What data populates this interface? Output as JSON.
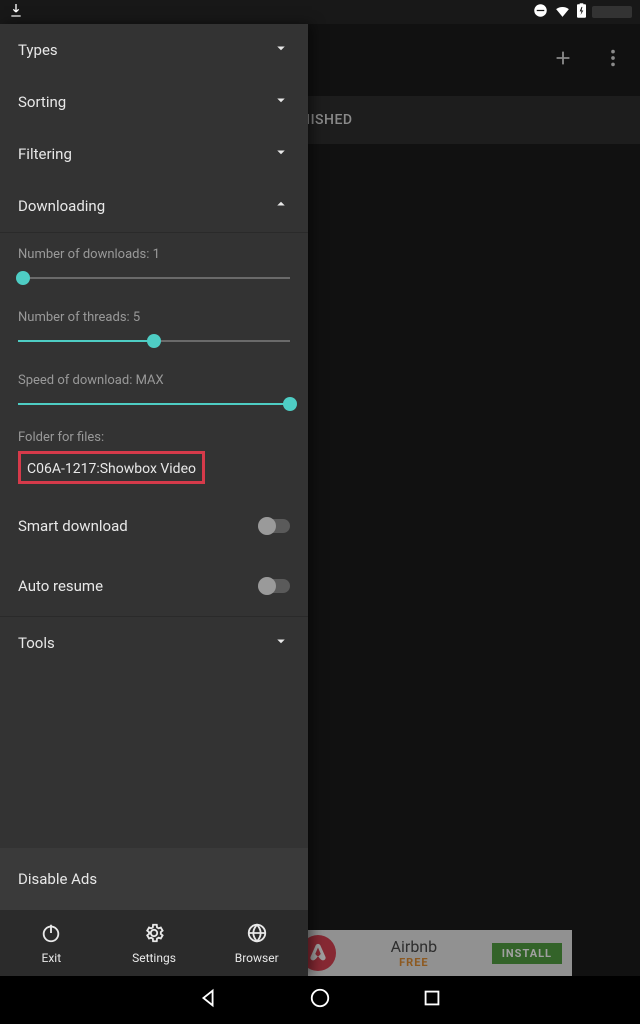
{
  "statusbar": {
    "dnd_icon": "do-not-disturb",
    "wifi_icon": "wifi",
    "batt_icon": "battery-charging"
  },
  "main": {
    "add_icon": "plus",
    "overflow_icon": "more-vert",
    "tab_finished": "FINISHED"
  },
  "ad": {
    "title": "Airbnb",
    "subtitle": "FREE",
    "button": "INSTALL"
  },
  "drawer": {
    "sections": {
      "types": "Types",
      "sorting": "Sorting",
      "filtering": "Filtering",
      "downloading": "Downloading",
      "tools": "Tools"
    },
    "downloading": {
      "num_downloads_label": "Number of downloads: 1",
      "num_downloads_pct": 2,
      "num_threads_label": "Number of threads: 5",
      "num_threads_pct": 50,
      "speed_label": "Speed of download: MAX",
      "speed_pct": 100,
      "folder_label": "Folder for files:",
      "folder_value": "C06A-1217:Showbox Video",
      "smart_download": "Smart download",
      "auto_resume": "Auto resume"
    },
    "disable_ads": "Disable Ads",
    "bottom": {
      "exit": "Exit",
      "settings": "Settings",
      "browser": "Browser"
    }
  }
}
